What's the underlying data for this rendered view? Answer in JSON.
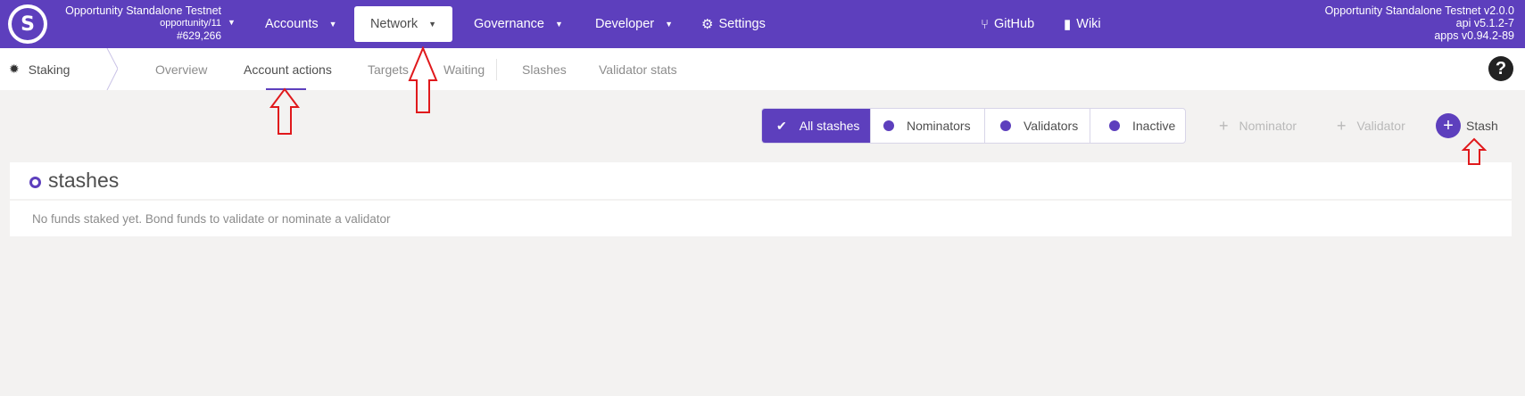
{
  "topbar": {
    "chain_name": "Opportunity Standalone Testnet",
    "chain_spec": "opportunity/11",
    "block_number": "#629,266",
    "menu": [
      {
        "label": "Accounts",
        "caret": true
      },
      {
        "label": "Network",
        "caret": true,
        "active": true
      },
      {
        "label": "Governance",
        "caret": true
      },
      {
        "label": "Developer",
        "caret": true
      },
      {
        "label": "Settings",
        "icon": "gears-icon"
      }
    ],
    "links": [
      {
        "label": "GitHub",
        "icon": "github-icon"
      },
      {
        "label": "Wiki",
        "icon": "book-icon"
      }
    ],
    "version": {
      "node": "Opportunity Standalone Testnet v2.0.0",
      "api": "api v5.1.2-7",
      "apps": "apps v0.94.2-89"
    }
  },
  "subnav": {
    "section": "Staking",
    "tabs": [
      {
        "label": "Overview"
      },
      {
        "label": "Account actions",
        "active": true
      },
      {
        "label": "Targets"
      },
      {
        "label": "Waiting"
      },
      {
        "label": "Slashes"
      },
      {
        "label": "Validator stats"
      }
    ],
    "help_glyph": "?"
  },
  "filters": [
    {
      "label": "All stashes",
      "active": true
    },
    {
      "label": "Nominators"
    },
    {
      "label": "Validators"
    },
    {
      "label": "Inactive"
    }
  ],
  "actions": {
    "nominator": "Nominator",
    "validator": "Validator",
    "stash": "Stash"
  },
  "table": {
    "title": "stashes",
    "empty_message": "No funds staked yet. Bond funds to validate or nominate a validator"
  },
  "colors": {
    "brand": "#5d3fbd",
    "annotation": "#e0191c"
  }
}
